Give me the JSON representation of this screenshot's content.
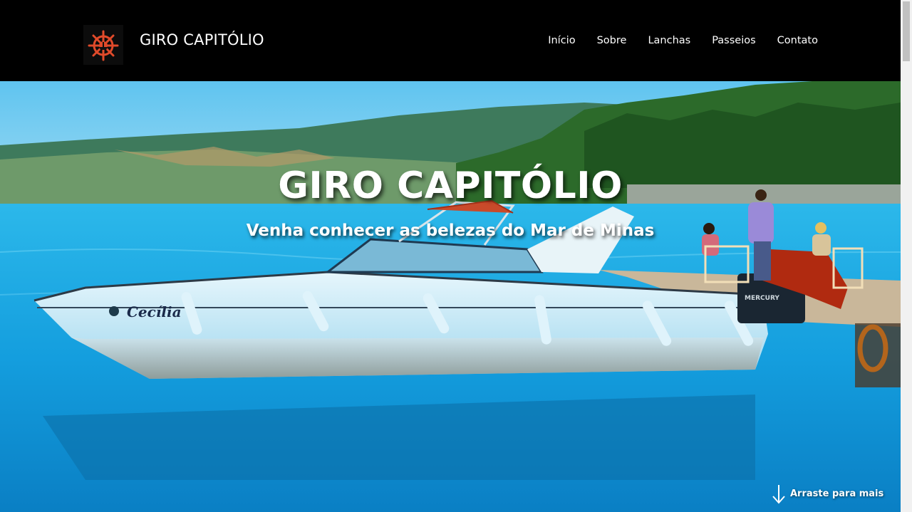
{
  "header": {
    "brand": "GIRO CAPITÓLIO",
    "logo_icon": "ship-wheel-icon",
    "nav": [
      {
        "label": "Início"
      },
      {
        "label": "Sobre"
      },
      {
        "label": "Lanchas"
      },
      {
        "label": "Passeios"
      },
      {
        "label": "Contato"
      }
    ]
  },
  "hero": {
    "title": "GIRO CAPITÓLIO",
    "subtitle": "Venha conhecer as belezas do Mar de Minas",
    "boat_name": "Cecília",
    "motor_brand": "MERCURY",
    "scroll_hint": "Arraste para mais",
    "scroll_icon": "arrow-down-icon"
  },
  "colors": {
    "navbar": "#000000",
    "logo_accent": "#e04a2a",
    "water": "#1aa6e6",
    "text": "#ffffff"
  }
}
